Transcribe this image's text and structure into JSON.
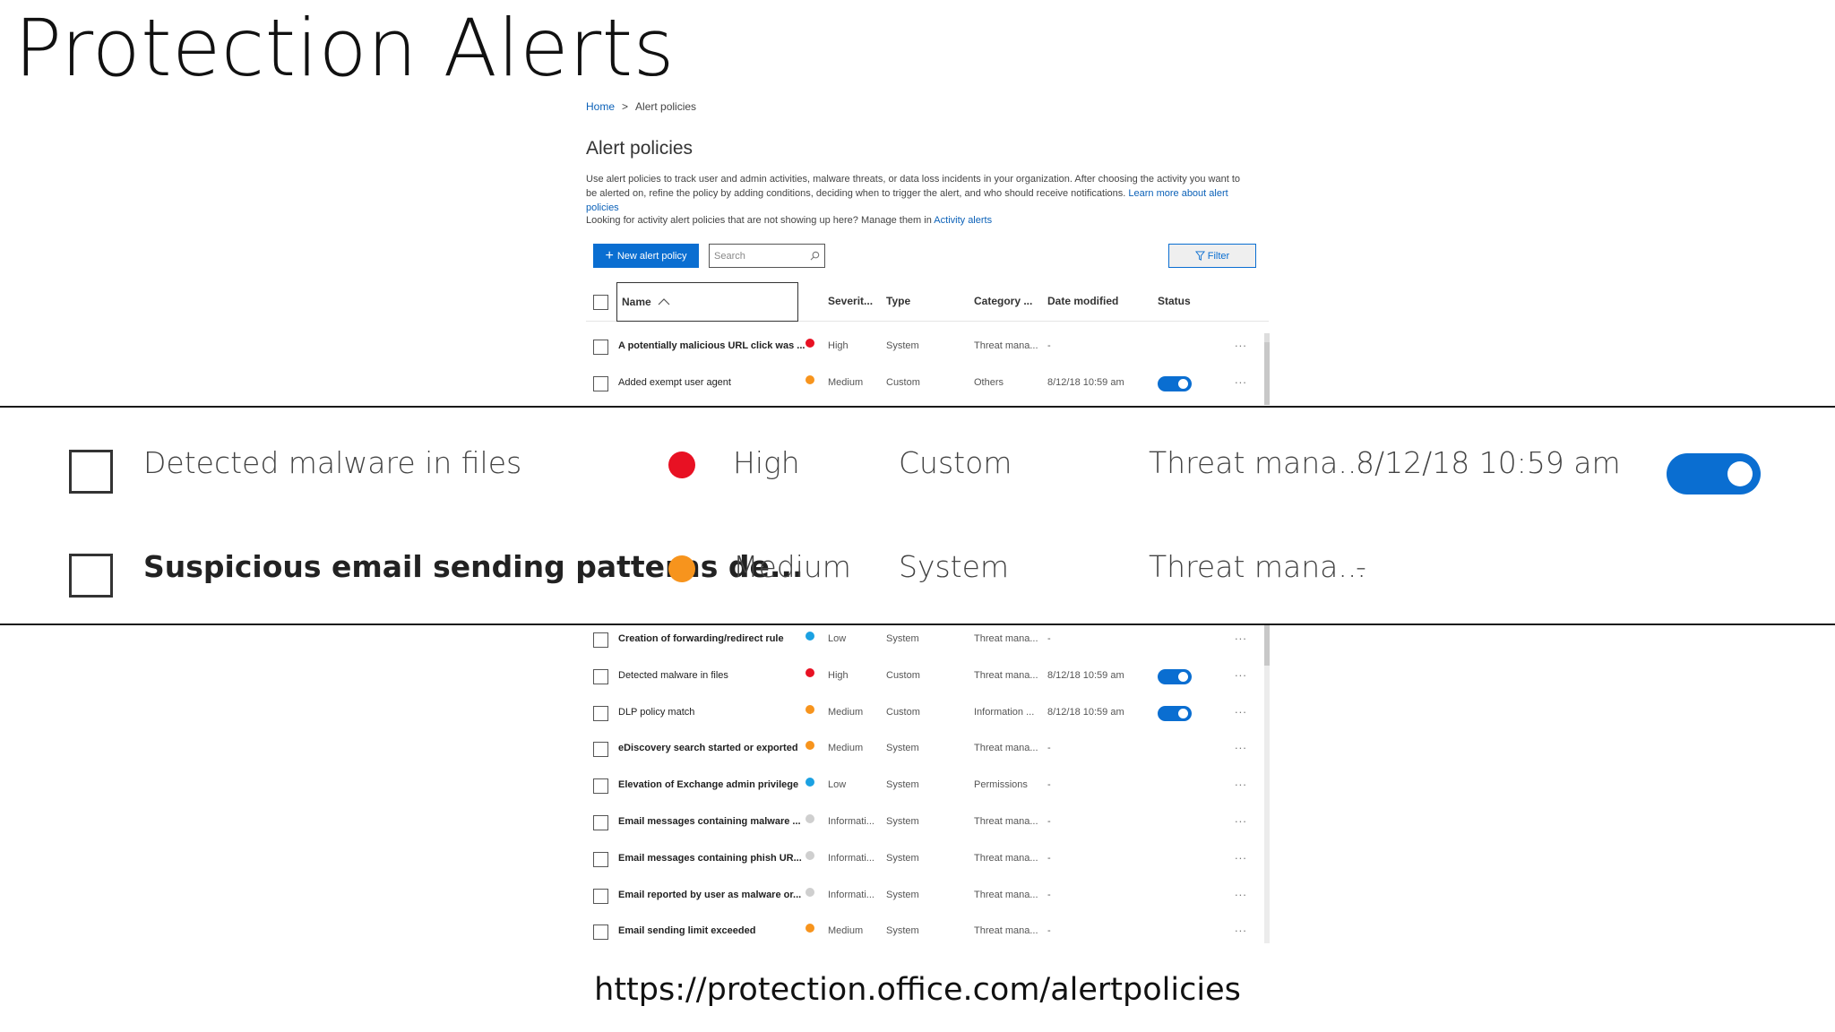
{
  "slide_title": "Protection Alerts",
  "breadcrumb": {
    "home": "Home",
    "sep": ">",
    "current": "Alert policies"
  },
  "page_heading": "Alert policies",
  "description": "Use alert policies to track user and admin activities, malware threats, or data loss incidents in your organization. After choosing the activity you want to be alerted on, refine the policy by adding conditions, deciding when to trigger the alert, and who should receive notifications.",
  "learn_more": "Learn more about alert policies",
  "description2": "Looking for activity alert policies that are not showing up here? Manage them in",
  "activity_alerts_link": "Activity alerts",
  "toolbar": {
    "new_label": "New alert policy",
    "search_placeholder": "Search",
    "filter_label": "Filter"
  },
  "columns": {
    "name": "Name",
    "severity": "Severit...",
    "type": "Type",
    "category": "Category ...",
    "date": "Date modified",
    "status": "Status"
  },
  "colors": {
    "high": "#e81123",
    "medium": "#f7941d",
    "low": "#1ba1e2",
    "info": "#cfcfcf",
    "accent": "#0a6ed1"
  },
  "rows_top": [
    {
      "name": "A potentially malicious URL click was ...",
      "bold": true,
      "severity": "High",
      "sev_color": "#e81123",
      "type": "System",
      "category": "Threat mana...",
      "date": "-",
      "toggle": false
    },
    {
      "name": "Added exempt user agent",
      "bold": false,
      "severity": "Medium",
      "sev_color": "#f7941d",
      "type": "Custom",
      "category": "Others",
      "date": "8/12/18 10:59 am",
      "toggle": true
    }
  ],
  "zoom_rows": [
    {
      "name": "Detected malware in files",
      "bold": false,
      "severity": "High",
      "sev_color": "#e81123",
      "type": "Custom",
      "category": "Threat mana...",
      "date": "8/12/18 10:59 am",
      "toggle": true
    },
    {
      "name": "Suspicious email sending patterns de...",
      "bold": true,
      "severity": "Medium",
      "sev_color": "#f7941d",
      "type": "System",
      "category": "Threat mana...",
      "date": "-",
      "toggle": false
    }
  ],
  "rows_bottom": [
    {
      "name": "Creation of forwarding/redirect rule",
      "bold": true,
      "severity": "Low",
      "sev_color": "#1ba1e2",
      "type": "System",
      "category": "Threat mana...",
      "date": "-",
      "toggle": false
    },
    {
      "name": "Detected malware in files",
      "bold": false,
      "severity": "High",
      "sev_color": "#e81123",
      "type": "Custom",
      "category": "Threat mana...",
      "date": "8/12/18 10:59 am",
      "toggle": true
    },
    {
      "name": "DLP policy match",
      "bold": false,
      "severity": "Medium",
      "sev_color": "#f7941d",
      "type": "Custom",
      "category": "Information ...",
      "date": "8/12/18 10:59 am",
      "toggle": true
    },
    {
      "name": "eDiscovery search started or exported",
      "bold": true,
      "severity": "Medium",
      "sev_color": "#f7941d",
      "type": "System",
      "category": "Threat mana...",
      "date": "-",
      "toggle": false
    },
    {
      "name": "Elevation of Exchange admin privilege",
      "bold": true,
      "severity": "Low",
      "sev_color": "#1ba1e2",
      "type": "System",
      "category": "Permissions",
      "date": "-",
      "toggle": false
    },
    {
      "name": "Email messages containing malware ...",
      "bold": true,
      "severity": "Informati...",
      "sev_color": "#cfcfcf",
      "type": "System",
      "category": "Threat mana...",
      "date": "-",
      "toggle": false
    },
    {
      "name": "Email messages containing phish UR...",
      "bold": true,
      "severity": "Informati...",
      "sev_color": "#cfcfcf",
      "type": "System",
      "category": "Threat mana...",
      "date": "-",
      "toggle": false
    },
    {
      "name": "Email reported by user as malware or...",
      "bold": true,
      "severity": "Informati...",
      "sev_color": "#cfcfcf",
      "type": "System",
      "category": "Threat mana...",
      "date": "-",
      "toggle": false
    },
    {
      "name": "Email sending limit exceeded",
      "bold": true,
      "severity": "Medium",
      "sev_color": "#f7941d",
      "type": "System",
      "category": "Threat mana...",
      "date": "-",
      "toggle": false
    }
  ],
  "more_label": "...",
  "url": "https://protection.office.com/alertpolicies"
}
